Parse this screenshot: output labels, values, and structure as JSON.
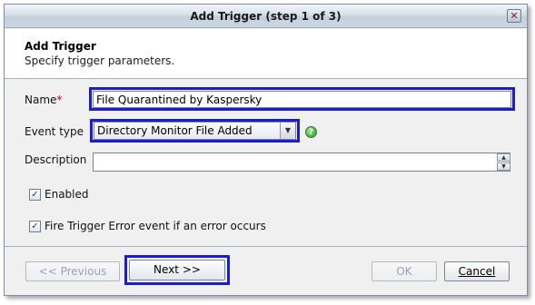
{
  "window": {
    "title": "Add Trigger (step 1 of 3)",
    "close_glyph": "✕"
  },
  "header": {
    "title": "Add Trigger",
    "subtitle": "Specify trigger parameters."
  },
  "form": {
    "name": {
      "label": "Name",
      "required_marker": "*",
      "value": "File Quarantined by Kaspersky"
    },
    "event_type": {
      "label": "Event type",
      "selected": "Directory Monitor File Added",
      "help_glyph": "?"
    },
    "description": {
      "label": "Description",
      "value": ""
    },
    "enabled": {
      "label": "Enabled",
      "checked": true,
      "glyph": "✓"
    },
    "fire_error": {
      "label": "Fire Trigger Error event if an error occurs",
      "checked": true,
      "glyph": "✓"
    }
  },
  "buttons": {
    "previous": "<< Previous",
    "next_label": "Next >>",
    "ok": "OK",
    "cancel": "Cancel"
  },
  "colors": {
    "highlight": "#1c1ccf",
    "required": "#c00000"
  }
}
